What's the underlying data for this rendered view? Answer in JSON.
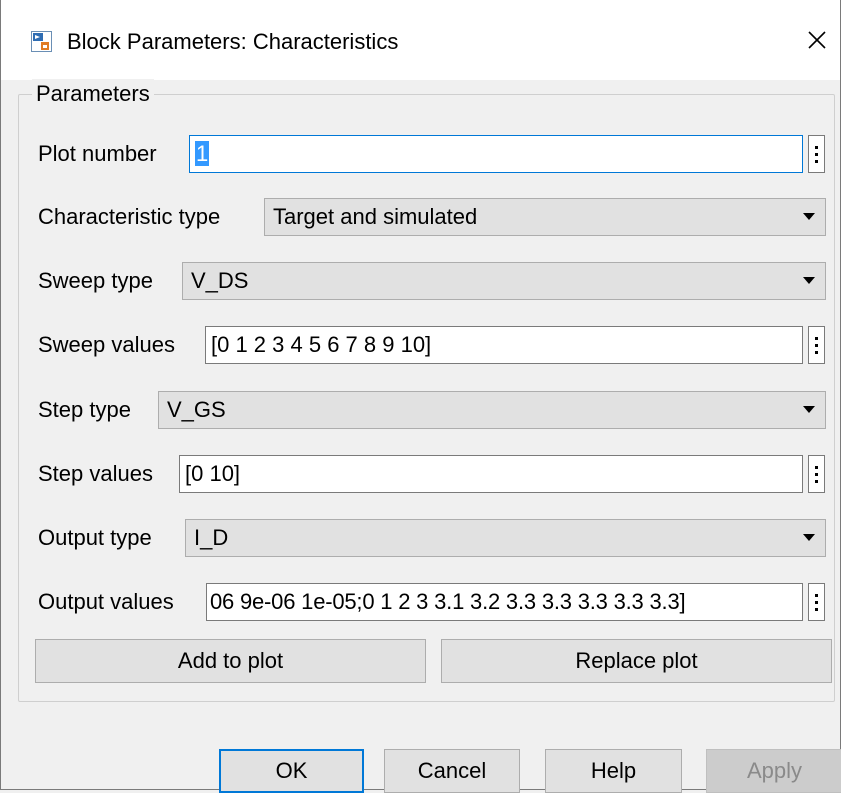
{
  "window": {
    "title": "Block Parameters: Characteristics",
    "close_glyph": "✕",
    "app_icon": "simulink-block-icon"
  },
  "parameters": {
    "group_title": "Parameters",
    "plot_number": {
      "label": "Plot number",
      "value": "1"
    },
    "characteristic_type": {
      "label": "Characteristic type",
      "value": "Target and simulated"
    },
    "sweep_type": {
      "label": "Sweep type",
      "value": "V_DS"
    },
    "sweep_values": {
      "label": "Sweep values",
      "value": "[0 1 2 3 4 5 6 7 8 9 10]"
    },
    "step_type": {
      "label": "Step type",
      "value": "V_GS"
    },
    "step_values": {
      "label": "Step values",
      "value": "[0 10]"
    },
    "output_type": {
      "label": "Output type",
      "value": "I_D"
    },
    "output_values": {
      "label": "Output values",
      "value": "06 9e-06 1e-05;0 1 2 3 3.1 3.2 3.3 3.3 3.3 3.3 3.3]"
    },
    "add_to_plot": "Add to plot",
    "replace_plot": "Replace plot"
  },
  "footer": {
    "ok": "OK",
    "cancel": "Cancel",
    "help": "Help",
    "apply": "Apply"
  },
  "colors": {
    "focus_border": "#0078d7",
    "selection": "#3399ff",
    "background": "#f0f0f0"
  }
}
